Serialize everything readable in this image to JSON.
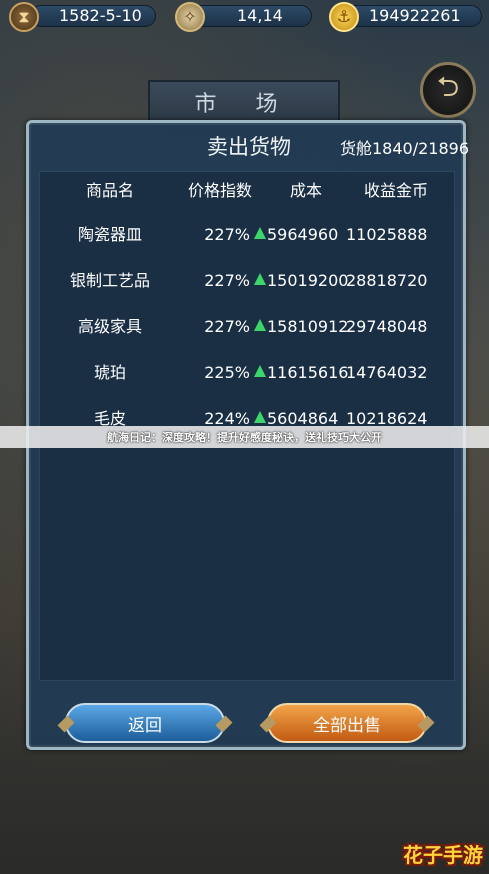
{
  "top_bar": {
    "date": "1582-5-10",
    "coordinates": "14,14",
    "gold": "194922261"
  },
  "market_sign": "市 场",
  "panel": {
    "title": "卖出货物",
    "cargo_label": "货舱",
    "cargo_value": "1840/21896",
    "headers": {
      "name": "商品名",
      "price_index": "价格指数",
      "cost": "成本",
      "revenue": "收益金币"
    },
    "rows": [
      {
        "name": "陶瓷器皿",
        "price_index": "227%",
        "cost": "5964960",
        "revenue": "11025888",
        "trend": "up"
      },
      {
        "name": "银制工艺品",
        "price_index": "227%",
        "cost": "15019200",
        "revenue": "28818720",
        "trend": "up"
      },
      {
        "name": "高级家具",
        "price_index": "227%",
        "cost": "15810912",
        "revenue": "29748048",
        "trend": "up"
      },
      {
        "name": "琥珀",
        "price_index": "225%",
        "cost": "11615616",
        "revenue": "14764032",
        "trend": "up"
      },
      {
        "name": "毛皮",
        "price_index": "224%",
        "cost": "5604864",
        "revenue": "10218624",
        "trend": "up"
      }
    ],
    "back_button": "返回",
    "sell_all_button": "全部出售"
  },
  "banner_text": "航海日记：深度攻略！提升好感度秘诀，送礼技巧大公开",
  "logo_text": "花子手游",
  "colors": {
    "trend_up": "#3ed66a",
    "back_button": "#2f7fc4",
    "sell_button": "#e07a25"
  }
}
